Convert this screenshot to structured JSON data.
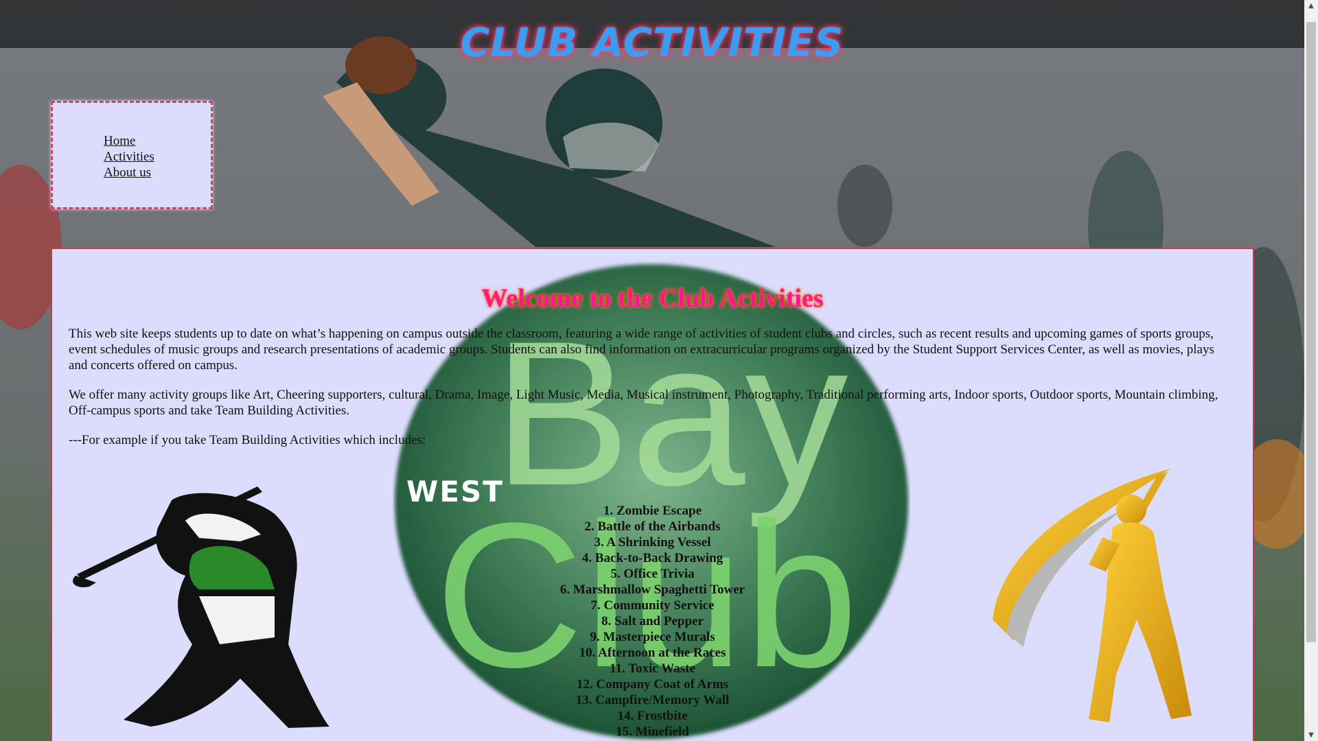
{
  "header": {
    "title": "CLUB ACTIVITIES"
  },
  "nav": {
    "items": [
      {
        "label": "Home"
      },
      {
        "label": "Activities"
      },
      {
        "label": "About us"
      }
    ]
  },
  "main": {
    "welcome": "Welcome to the Club Activities",
    "paragraphs": [
      "This web site keeps students up to date on what’s happening on campus outside the classroom, featuring a wide range of activities of student clubs and circles, such as recent results and upcoming games of sports groups, event schedules of music groups and research presentations of academic groups. Students can also find information on extracurricular programs organized by the Student Support Services Center, as well as movies, plays and concerts offered on campus.",
      "We offer many activity groups like Art, Cheering supporters, cultural, Drama, Image, Light Music, Media, Musical instrument, Photography, Traditional performing arts, Indoor sports, Outdoor sports, Mountain climbing, Off-campus sports and take Team Building Activities.",
      "---For example if you take Team Building Activities which includes:"
    ],
    "activities": [
      "1. Zombie Escape",
      "2. Battle of the Airbands",
      "3. A Shrinking Vessel",
      "4. Back-to-Back Drawing",
      "5. Office Trivia",
      "6. Marshmallow Spaghetti Tower",
      "7. Community Service",
      "8. Salt and Pepper",
      "9. Masterpiece Murals",
      "10. Afternoon at the Races",
      "11. Toxic Waste",
      "12. Company Coat of Arms",
      "13. Campfire/Memory Wall",
      "14. Frostbite",
      "15. Minefield"
    ],
    "logo": {
      "line1": "WEST",
      "line2": "Bay",
      "line3": "Club"
    }
  },
  "icons": {
    "scroll_up": "scroll-up-arrow-icon",
    "scroll_down": "scroll-down-arrow-icon"
  },
  "colors": {
    "title": "#3b9df0",
    "title_glow": "#ff3b6b",
    "panel_bg": "#dcdcfc",
    "panel_border": "#c0404a",
    "nav_border": "#c8466e",
    "welcome": "#ff1493",
    "logo_green_dark": "#1f5a3a",
    "logo_green_light": "#7ecb6a"
  }
}
